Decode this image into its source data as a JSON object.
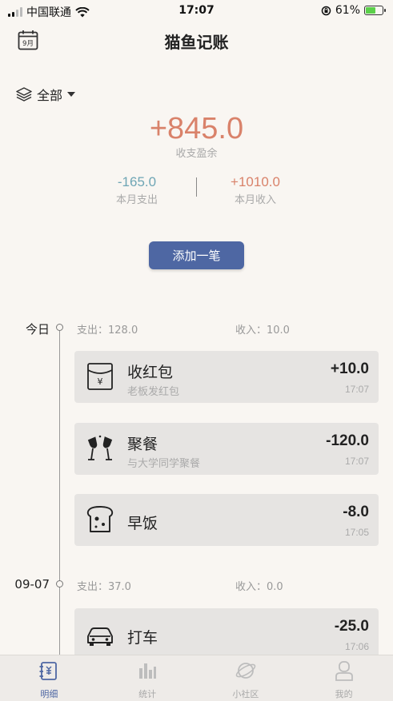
{
  "status_bar": {
    "carrier": "中国联通",
    "time": "17:07",
    "battery": "61%",
    "battery_level": 0.61
  },
  "header": {
    "title": "猫鱼记账",
    "calendar_badge": "9月"
  },
  "filter": {
    "label": "全部"
  },
  "summary": {
    "balance": "+845.0",
    "balance_label": "收支盈余",
    "expense": "-165.0",
    "expense_label": "本月支出",
    "income": "+1010.0",
    "income_label": "本月收入"
  },
  "add_button": {
    "label": "添加一笔"
  },
  "days": [
    {
      "date": "今日",
      "expense": "支出：128.0",
      "income": "收入：10.0",
      "records": [
        {
          "icon": "red-envelope-icon",
          "title": "收红包",
          "note": "老板发红包",
          "amount": "+10.0",
          "time": "17:07"
        },
        {
          "icon": "champagne-icon",
          "title": "聚餐",
          "note": "与大学同学聚餐",
          "amount": "-120.0",
          "time": "17:07"
        },
        {
          "icon": "toast-icon",
          "title": "早饭",
          "note": "",
          "amount": "-8.0",
          "time": "17:05"
        }
      ]
    },
    {
      "date": "09-07",
      "expense": "支出：37.0",
      "income": "收入：0.0",
      "records": [
        {
          "icon": "car-icon",
          "title": "打车",
          "note": "",
          "amount": "-25.0",
          "time": "17:06"
        }
      ]
    }
  ],
  "tabbar": [
    {
      "label": "明细",
      "icon": "ledger-icon",
      "active": true
    },
    {
      "label": "统计",
      "icon": "bar-chart-icon",
      "active": false
    },
    {
      "label": "小社区",
      "icon": "planet-icon",
      "active": false
    },
    {
      "label": "我的",
      "icon": "user-icon",
      "active": false
    }
  ],
  "colors": {
    "accent": "#4e67a3",
    "balance": "#d9826a",
    "expense": "#6fa6b5",
    "income": "#d9826a"
  }
}
